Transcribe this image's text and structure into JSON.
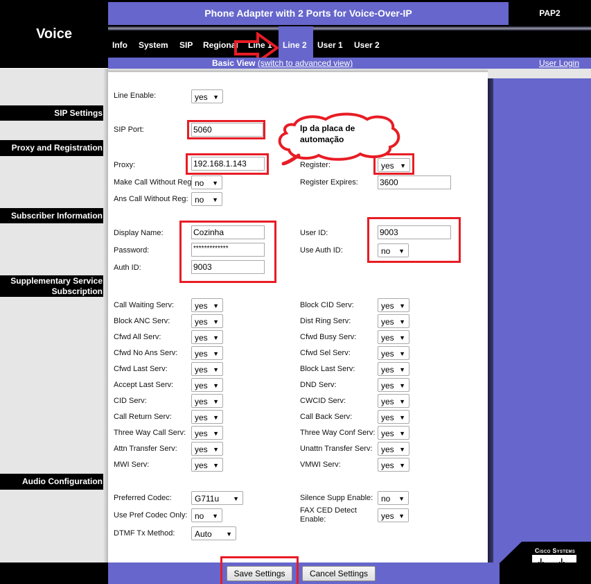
{
  "header": {
    "app_title": "Voice",
    "page_title": "Phone Adapter with 2 Ports for Voice-Over-IP",
    "model": "PAP2"
  },
  "nav": {
    "tabs": [
      "Info",
      "System",
      "SIP",
      "Regional",
      "Line 1",
      "Line 2",
      "User 1",
      "User 2"
    ],
    "active_tab": "Line 2",
    "view_label": "Basic View",
    "switch_link": "(switch to advanced view)",
    "user_login": "User Login"
  },
  "sections": {
    "sip_settings": "SIP Settings",
    "proxy_registration": "Proxy and Registration",
    "subscriber_info": "Subscriber Information",
    "supplementary_1": "Supplementary Service",
    "supplementary_2": "Subscription",
    "audio_config": "Audio Configuration"
  },
  "fields": {
    "line_enable": {
      "label": "Line Enable:",
      "value": "yes"
    },
    "sip_port": {
      "label": "SIP Port:",
      "value": "5060"
    },
    "proxy": {
      "label": "Proxy:",
      "value": "192.168.1.143"
    },
    "register": {
      "label": "Register:",
      "value": "yes"
    },
    "make_call_without_reg": {
      "label": "Make Call Without Reg:",
      "value": "no"
    },
    "register_expires": {
      "label": "Register Expires:",
      "value": "3600"
    },
    "ans_call_without_reg": {
      "label": "Ans Call Without Reg:",
      "value": "no"
    },
    "display_name": {
      "label": "Display Name:",
      "value": "Cozinha"
    },
    "user_id": {
      "label": "User ID:",
      "value": "9003"
    },
    "password": {
      "label": "Password:",
      "value": "*************"
    },
    "use_auth_id": {
      "label": "Use Auth ID:",
      "value": "no"
    },
    "auth_id": {
      "label": "Auth ID:",
      "value": "9003"
    }
  },
  "supplementary": {
    "left": [
      {
        "label": "Call Waiting Serv:",
        "value": "yes"
      },
      {
        "label": "Block ANC Serv:",
        "value": "yes"
      },
      {
        "label": "Cfwd All Serv:",
        "value": "yes"
      },
      {
        "label": "Cfwd No Ans Serv:",
        "value": "yes"
      },
      {
        "label": "Cfwd Last Serv:",
        "value": "yes"
      },
      {
        "label": "Accept Last Serv:",
        "value": "yes"
      },
      {
        "label": "CID Serv:",
        "value": "yes"
      },
      {
        "label": "Call Return Serv:",
        "value": "yes"
      },
      {
        "label": "Three Way Call Serv:",
        "value": "yes"
      },
      {
        "label": "Attn Transfer Serv:",
        "value": "yes"
      },
      {
        "label": "MWI Serv:",
        "value": "yes"
      }
    ],
    "right": [
      {
        "label": "Block CID Serv:",
        "value": "yes"
      },
      {
        "label": "Dist Ring Serv:",
        "value": "yes"
      },
      {
        "label": "Cfwd Busy Serv:",
        "value": "yes"
      },
      {
        "label": "Cfwd Sel Serv:",
        "value": "yes"
      },
      {
        "label": "Block Last Serv:",
        "value": "yes"
      },
      {
        "label": "DND Serv:",
        "value": "yes"
      },
      {
        "label": "CWCID Serv:",
        "value": "yes"
      },
      {
        "label": "Call Back Serv:",
        "value": "yes"
      },
      {
        "label": "Three Way Conf Serv:",
        "value": "yes"
      },
      {
        "label": "Unattn Transfer Serv:",
        "value": "yes"
      },
      {
        "label": "VMWI Serv:",
        "value": "yes"
      }
    ]
  },
  "audio": {
    "preferred_codec": {
      "label": "Preferred Codec:",
      "value": "G711u"
    },
    "silence_supp": {
      "label": "Silence Supp Enable:",
      "value": "no"
    },
    "use_pref_codec_only": {
      "label": "Use Pref Codec Only:",
      "value": "no"
    },
    "fax_ced_detect": {
      "label": "FAX CED Detect Enable:",
      "value": "yes"
    },
    "dtmf_tx_method": {
      "label": "DTMF Tx Method:",
      "value": "Auto"
    }
  },
  "buttons": {
    "save": "Save Settings",
    "cancel": "Cancel Settings"
  },
  "annotation": {
    "cloud_line1": "Ip da placa de",
    "cloud_line2": "automação"
  },
  "brand": {
    "logo_text": "Cisco Systems",
    "accent_color": "#6666cc",
    "annotation_color": "#e81c24"
  }
}
